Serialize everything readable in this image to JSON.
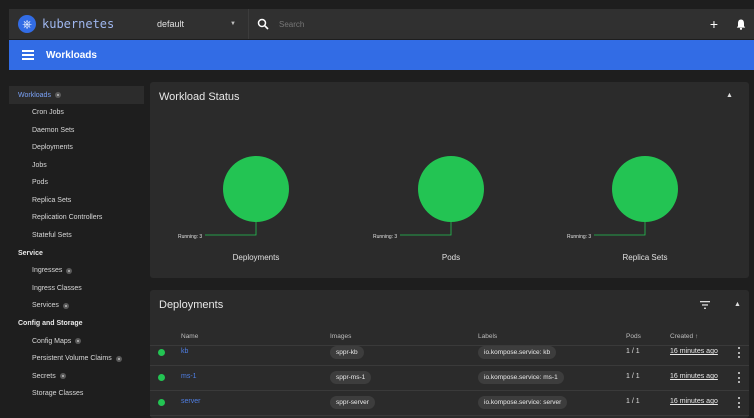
{
  "topbar": {
    "logo_text": "kubernetes",
    "namespace": "default",
    "search_placeholder": "Search",
    "add_label": "+"
  },
  "titlebar": {
    "title": "Workloads"
  },
  "sidebar": {
    "workloads": {
      "label": "Workloads",
      "items": [
        "Cron Jobs",
        "Daemon Sets",
        "Deployments",
        "Jobs",
        "Pods",
        "Replica Sets",
        "Replication Controllers",
        "Stateful Sets"
      ]
    },
    "service": {
      "label": "Service",
      "items": [
        "Ingresses",
        "Ingress Classes",
        "Services"
      ]
    },
    "config": {
      "label": "Config and Storage",
      "items": [
        "Config Maps",
        "Persistent Volume Claims",
        "Secrets",
        "Storage Classes"
      ]
    }
  },
  "workload_status": {
    "title": "Workload Status",
    "charts": [
      {
        "name": "Deployments",
        "label": "Running: 3",
        "running": 3
      },
      {
        "name": "Pods",
        "label": "Running: 3",
        "running": 3
      },
      {
        "name": "Replica Sets",
        "label": "Running: 3",
        "running": 3
      }
    ],
    "running_color": "#23c453"
  },
  "deployments": {
    "title": "Deployments",
    "columns": [
      "Name",
      "Images",
      "Labels",
      "Pods",
      "Created"
    ],
    "sort_indicator": "↑",
    "rows": [
      {
        "name": "kb",
        "image": "sppr-kb",
        "label": "io.kompose.service: kb",
        "pods": "1 / 1",
        "created": "16 minutes ago"
      },
      {
        "name": "ms-1",
        "image": "sppr-ms-1",
        "label": "io.kompose.service: ms-1",
        "pods": "1 / 1",
        "created": "16 minutes ago"
      },
      {
        "name": "server",
        "image": "sppr-server",
        "label": "io.kompose.service: server",
        "pods": "1 / 1",
        "created": "16 minutes ago"
      }
    ]
  },
  "colors": {
    "accent": "#326ce5",
    "running": "#23c453",
    "link": "#4f7fe5"
  }
}
